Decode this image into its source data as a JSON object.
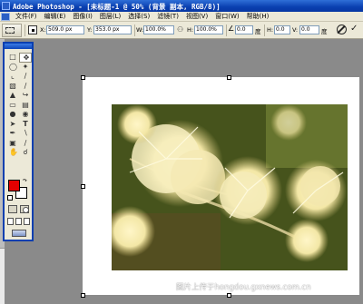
{
  "window": {
    "title": "Adobe Photoshop - [未标题-1 @ 50% (背景 副本, RGB/8)]"
  },
  "menu": [
    "文件(F)",
    "编辑(E)",
    "图像(I)",
    "图层(L)",
    "选择(S)",
    "滤镜(T)",
    "视图(V)",
    "窗口(W)",
    "帮助(H)"
  ],
  "options": {
    "x_label": "X:",
    "x_value": "509.0 px",
    "y_label": "Y:",
    "y_value": "353.0 px",
    "w_label": "W:",
    "w_value": "100.0%",
    "h_label": "H:",
    "h_value": "100.0%",
    "rotate_value": "0.0",
    "deg_label": "度",
    "hskew_label": "H:",
    "hskew_value": "0.0",
    "vskew_label": "V:",
    "vskew_value": "0.0",
    "deg_label2": "度"
  },
  "toolbox": {
    "foreground_color": "#e30000",
    "background_color": "#ffffff"
  },
  "watermark": "图片上传于hongdou.gxnews.com.cn"
}
